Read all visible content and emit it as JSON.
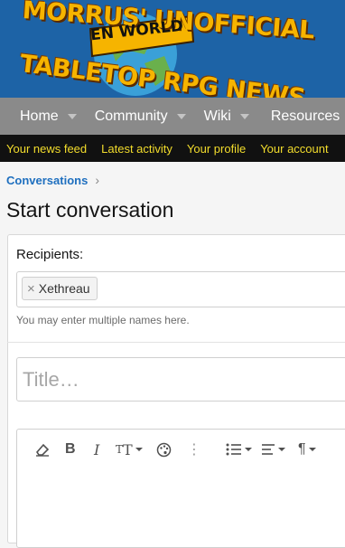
{
  "banner": {
    "logo_line1": "MORRUS' UNOFFICIAL",
    "logo_badge": "EN WORLD",
    "logo_line2": "TABLETOP RPG NEWS"
  },
  "nav": {
    "items": [
      {
        "label": "Home"
      },
      {
        "label": "Community"
      },
      {
        "label": "Wiki"
      },
      {
        "label": "Resources"
      }
    ]
  },
  "subnav": {
    "items": [
      "Your news feed",
      "Latest activity",
      "Your profile",
      "Your account"
    ]
  },
  "breadcrumb": {
    "label": "Conversations"
  },
  "page": {
    "title": "Start conversation"
  },
  "form": {
    "recipients_label": "Recipients:",
    "recipient_tag": "Xethreau",
    "recipients_hint": "You may enter multiple names here.",
    "title_placeholder": "Title…"
  },
  "toolbar": {
    "icons": [
      "eraser-icon",
      "bold-icon",
      "italic-icon",
      "text-size-icon",
      "palette-icon",
      "more-icon",
      "list-icon",
      "align-icon",
      "paragraph-icon"
    ]
  },
  "colors": {
    "banner": "#1d63a6",
    "nav": "#8a8a8a",
    "subnav": "#111111",
    "subnav_link": "#f2dc2c",
    "link": "#1e6fbf",
    "logo": "#f6b400"
  }
}
